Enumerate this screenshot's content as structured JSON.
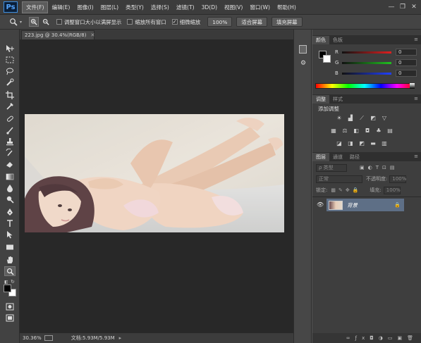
{
  "app": {
    "logo": "Ps"
  },
  "menu": [
    "文件(F)",
    "编辑(E)",
    "图像(I)",
    "图层(L)",
    "类型(Y)",
    "选择(S)",
    "滤镜(T)",
    "3D(D)",
    "视图(V)",
    "窗口(W)",
    "帮助(H)"
  ],
  "window_controls": {
    "minimize": "—",
    "restore": "❐",
    "close": "✕"
  },
  "options": {
    "resize_windows_label": "调整窗口大小以满屏显示",
    "zoom_all_label": "缩放所有窗口",
    "scrubby_zoom_label": "细微缩放",
    "btn_100": "100%",
    "btn_fit": "适合屏幕",
    "btn_fill": "填充屏幕"
  },
  "document": {
    "tab_title": "223.jpg @ 30.4%(RGB/8)",
    "zoom": "30.36%",
    "doc_info": "文档:5.93M/5.93M"
  },
  "color_panel": {
    "tabs": [
      "颜色",
      "色板"
    ],
    "channels": [
      {
        "label": "R",
        "value": "0",
        "color": "#d03030"
      },
      {
        "label": "G",
        "value": "0",
        "color": "#30b030"
      },
      {
        "label": "B",
        "value": "0",
        "color": "#3040d8"
      }
    ]
  },
  "adjustments_panel": {
    "tabs": [
      "调整",
      "样式"
    ],
    "title": "添加调整"
  },
  "layers_panel": {
    "tabs": [
      "图层",
      "通道",
      "路径"
    ],
    "filter_kind": "ρ 类型",
    "blend_mode": "正常",
    "opacity_label": "不透明度:",
    "opacity_value": "100%",
    "lock_label": "锁定:",
    "fill_label": "填充:",
    "fill_value": "100%",
    "layers": [
      {
        "name": "背景"
      }
    ]
  },
  "icons": {
    "zoom_tool": "magnifier-icon",
    "lock": "lock-icon",
    "eye": "eye-icon"
  },
  "colors": {
    "accent": "#3d8ee0",
    "panel_bg": "#3e3e3e",
    "canvas_bg": "#282828",
    "layer_selected": "#5e6f86"
  }
}
